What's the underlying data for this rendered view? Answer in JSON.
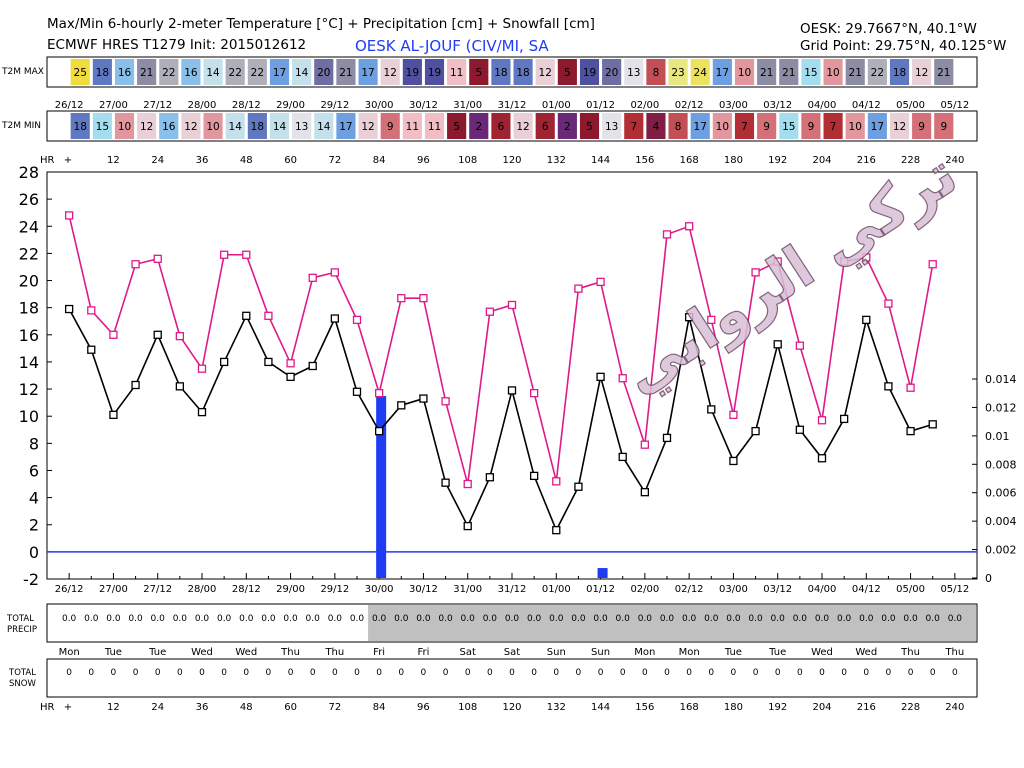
{
  "header": {
    "title_line1": "Max/Min 6-hourly 2-meter Temperature [°C] + Precipitation [cm] + Snowfall [cm]",
    "title_line2": "ECMWF HRES T1279 Init: 2015012612",
    "station_name": "OESK AL-JOUF (CIV/MI, SA",
    "station_coords": "OESK: 29.7667°N, 40.1°W",
    "grid_point": "Grid Point: 29.75°N, 40.125°W"
  },
  "watermark": "تركي الروابي",
  "strip_labels": {
    "max": "T2M MAX",
    "min": "T2M MIN",
    "hr": "HR",
    "total_precip_1": "TOTAL",
    "total_precip_2": "PRECIP",
    "total_snow_1": "TOTAL",
    "total_snow_2": "SNOW"
  },
  "hr_labels": [
    "+",
    "12",
    "24",
    "36",
    "48",
    "60",
    "72",
    "84",
    "96",
    "108",
    "120",
    "132",
    "144",
    "156",
    "168",
    "180",
    "192",
    "204",
    "216",
    "228",
    "240"
  ],
  "date_labels": [
    "26/12",
    "27/00",
    "27/12",
    "28/00",
    "28/12",
    "29/00",
    "29/12",
    "30/00",
    "30/12",
    "31/00",
    "31/12",
    "01/00",
    "01/12",
    "02/00",
    "02/12",
    "03/00",
    "03/12",
    "04/00",
    "04/12",
    "05/00",
    "05/12"
  ],
  "day_labels": [
    "Mon",
    "Tue",
    "Tue",
    "Wed",
    "Wed",
    "Thu",
    "Thu",
    "Fri",
    "Fri",
    "Sat",
    "Sat",
    "Sun",
    "Sun",
    "Mon",
    "Mon",
    "Tue",
    "Tue",
    "Wed",
    "Wed",
    "Thu",
    "Thu"
  ],
  "tmax_strip": [
    "25",
    "18",
    "16",
    "21",
    "22",
    "16",
    "14",
    "22",
    "22",
    "17",
    "14",
    "20",
    "21",
    "17",
    "12",
    "19",
    "19",
    "11",
    "5",
    "18",
    "18",
    "12",
    "5",
    "19",
    "20",
    "13",
    "8",
    "23",
    "24",
    "17",
    "10",
    "21",
    "21",
    "15",
    "10",
    "21",
    "22",
    "18",
    "12",
    "21"
  ],
  "tmin_strip": [
    "18",
    "15",
    "10",
    "12",
    "16",
    "12",
    "10",
    "14",
    "18",
    "14",
    "13",
    "14",
    "17",
    "12",
    "9",
    "11",
    "11",
    "5",
    "2",
    "6",
    "12",
    "6",
    "2",
    "5",
    "13",
    "7",
    "4",
    "8",
    "17",
    "10",
    "7",
    "9",
    "15",
    "9",
    "7",
    "10",
    "17",
    "12",
    "9",
    "9"
  ],
  "total_precip_values": [
    "0.0",
    "0.0",
    "0.0",
    "0.0",
    "0.0",
    "0.0",
    "0.0",
    "0.0",
    "0.0",
    "0.0",
    "0.0",
    "0.0",
    "0.0",
    "0.0",
    "0.0",
    "0.0",
    "0.0",
    "0.0",
    "0.0",
    "0.0",
    "0.0",
    "0.0",
    "0.0",
    "0.0",
    "0.0",
    "0.0",
    "0.0",
    "0.0",
    "0.0",
    "0.0",
    "0.0",
    "0.0",
    "0.0",
    "0.0",
    "0.0",
    "0.0",
    "0.0",
    "0.0",
    "0.0",
    "0.0",
    "0.0"
  ],
  "total_snow_values": [
    "0",
    "0",
    "0",
    "0",
    "0",
    "0",
    "0",
    "0",
    "0",
    "0",
    "0",
    "0",
    "0",
    "0",
    "0",
    "0",
    "0",
    "0",
    "0",
    "0",
    "0",
    "0",
    "0",
    "0",
    "0",
    "0",
    "0",
    "0",
    "0",
    "0",
    "0",
    "0",
    "0",
    "0",
    "0",
    "0",
    "0",
    "0",
    "0",
    "0",
    "0"
  ],
  "colors": {
    "max_line": "#e0198a",
    "min_line": "#000000",
    "precip_bar": "#1f3cf5",
    "zero_line": "#1f3cf5",
    "precip_shade": "#c0c0c0"
  },
  "chart_data": {
    "type": "line",
    "x_hours": [
      0,
      6,
      12,
      18,
      24,
      30,
      36,
      42,
      48,
      54,
      60,
      66,
      72,
      78,
      84,
      90,
      96,
      102,
      108,
      114,
      120,
      126,
      132,
      138,
      144,
      150,
      156,
      162,
      168,
      174,
      180,
      186,
      192,
      198,
      204,
      210,
      216,
      222,
      228,
      234,
      240
    ],
    "series": [
      {
        "values": [
          24.8,
          17.8,
          16.0,
          21.2,
          21.6,
          15.9,
          13.5,
          21.9,
          21.9,
          17.4,
          13.9,
          20.2,
          20.6,
          17.1,
          11.7,
          18.7,
          18.7,
          11.1,
          5.0,
          17.7,
          18.2,
          11.7,
          5.2,
          19.4,
          19.9,
          12.8,
          7.9,
          23.4,
          24.0,
          17.1,
          10.1,
          20.6,
          21.4,
          15.2,
          9.7,
          21.4,
          21.7,
          18.3,
          12.1,
          21.2
        ]
      },
      {
        "values": [
          17.9,
          14.9,
          10.1,
          12.3,
          16.0,
          12.2,
          10.3,
          14.0,
          17.4,
          14.0,
          12.9,
          13.7,
          17.2,
          11.8,
          8.9,
          10.8,
          11.3,
          5.1,
          1.9,
          5.5,
          11.9,
          5.6,
          1.6,
          4.8,
          12.9,
          7.0,
          4.4,
          8.4,
          17.3,
          10.5,
          6.7,
          8.9,
          15.3,
          9.0,
          6.9,
          9.8,
          17.1,
          12.2,
          8.9,
          9.4
        ]
      }
    ],
    "precip": [
      {
        "x": 84,
        "value": 0.0128
      },
      {
        "x": 144,
        "value": 0.0007
      }
    ],
    "y_left": {
      "min": -2,
      "max": 28,
      "ticks": [
        -2,
        0,
        2,
        4,
        6,
        8,
        10,
        12,
        14,
        16,
        18,
        20,
        22,
        24,
        26,
        28
      ]
    },
    "y_right": {
      "min": 0,
      "max": 0.014,
      "ticks": [
        "0",
        "0.002",
        "0.004",
        "0.006",
        "0.008",
        "0.01",
        "0.012",
        "0.014"
      ]
    },
    "xlim": [
      -6,
      246
    ],
    "grid": false
  }
}
